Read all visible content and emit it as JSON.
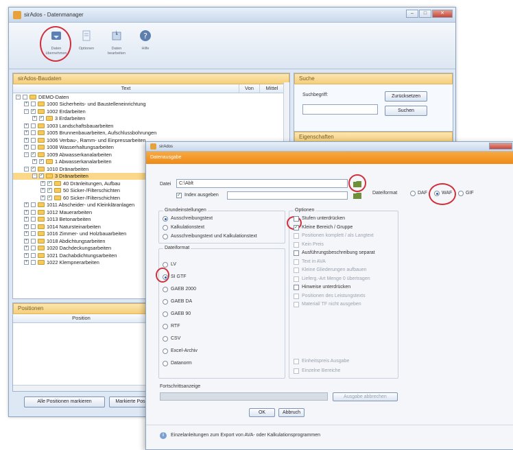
{
  "main_window": {
    "title": "sirAdos - Datenmanager",
    "controls": [
      "–",
      "□",
      "✕"
    ],
    "ribbon": [
      {
        "label": "Daten übernehmen",
        "icon": "data-transfer-icon"
      },
      {
        "label": "Optionen",
        "icon": "options-icon"
      },
      {
        "label": "Daten bearbeiten",
        "icon": "edit-data-icon"
      },
      {
        "label": "Hilfe",
        "icon": "help-icon"
      }
    ]
  },
  "left_panel": {
    "header": "sirAdos-Baudaten",
    "columns": [
      "Text",
      "Von",
      "Mittel"
    ],
    "rows": [
      {
        "indent": 0,
        "pm": "−",
        "checked": false,
        "text": "DEMO-Daten",
        "selected": false
      },
      {
        "indent": 1,
        "pm": "+",
        "checked": false,
        "text": "1000 Sicherheits- und Baustelleneinrichtung",
        "selected": false
      },
      {
        "indent": 1,
        "pm": "−",
        "checked": true,
        "text": "1002 Erdarbeiten",
        "selected": false
      },
      {
        "indent": 2,
        "pm": "+",
        "checked": true,
        "text": "3 Erdarbeiten",
        "selected": false
      },
      {
        "indent": 1,
        "pm": "+",
        "checked": false,
        "text": "1003 Landschaftsbauarbeiten",
        "selected": false
      },
      {
        "indent": 1,
        "pm": "+",
        "checked": false,
        "text": "1005 Brunnenbauarbeiten, Aufschlussbohrungen",
        "selected": false
      },
      {
        "indent": 1,
        "pm": "+",
        "checked": false,
        "text": "1006 Verbau-, Ramm- und Einpressarbeiten",
        "selected": false
      },
      {
        "indent": 1,
        "pm": "+",
        "checked": false,
        "text": "1008 Wasserhaltungsarbeiten",
        "selected": false
      },
      {
        "indent": 1,
        "pm": "−",
        "checked": true,
        "text": "1009 Abwasserkanalarbeiten",
        "selected": false
      },
      {
        "indent": 2,
        "pm": "+",
        "checked": true,
        "text": "1 Abwasserkanalarbeiten",
        "selected": false
      },
      {
        "indent": 1,
        "pm": "−",
        "checked": true,
        "text": "1010 Dränarbeiten",
        "selected": false
      },
      {
        "indent": 2,
        "pm": "−",
        "checked": true,
        "text": "3 Dränarbeiten",
        "selected": true
      },
      {
        "indent": 3,
        "pm": "+",
        "checked": true,
        "text": "40 Dränleitungen, Aufbau",
        "selected": false
      },
      {
        "indent": 3,
        "pm": "+",
        "checked": true,
        "text": "50 Sicker-/Filterschichten",
        "selected": false
      },
      {
        "indent": 3,
        "pm": "+",
        "checked": true,
        "text": "60 Sicker-/Filterschichten",
        "selected": false
      },
      {
        "indent": 1,
        "pm": "+",
        "checked": false,
        "text": "1011 Abscheider- und Kleinkläranlagen",
        "selected": false
      },
      {
        "indent": 1,
        "pm": "+",
        "checked": false,
        "text": "1012 Mauerarbeiten",
        "selected": false
      },
      {
        "indent": 1,
        "pm": "+",
        "checked": false,
        "text": "1013 Betonarbeiten",
        "selected": false
      },
      {
        "indent": 1,
        "pm": "+",
        "checked": false,
        "text": "1014 Natursteinarbeiten",
        "selected": false
      },
      {
        "indent": 1,
        "pm": "+",
        "checked": false,
        "text": "1016 Zimmer- und Holzbauarbeiten",
        "selected": false
      },
      {
        "indent": 1,
        "pm": "+",
        "checked": false,
        "text": "1018 Abdichtungsarbeiten",
        "selected": false
      },
      {
        "indent": 1,
        "pm": "+",
        "checked": false,
        "text": "1020 Dachdeckungsarbeiten",
        "selected": false
      },
      {
        "indent": 1,
        "pm": "+",
        "checked": false,
        "text": "1021 Dachabdichtungsarbeiten",
        "selected": false
      },
      {
        "indent": 1,
        "pm": "+",
        "checked": false,
        "text": "1022 Klempnerarbeiten",
        "selected": false
      }
    ]
  },
  "search_panel": {
    "header": "Suche",
    "label": "Suchbegriff:",
    "reset_button": "Zurücksetzen",
    "search_button": "Suchen"
  },
  "properties_panel": {
    "header": "Eigenschaften"
  },
  "bottom_panel": {
    "header": "Positionen",
    "column": "Position",
    "btn_all": "Alle Positionen markieren",
    "btn_marked": "Markierte Pos"
  },
  "dialog": {
    "title": "sirAdos",
    "header": "Datenausgabe",
    "file_label": "Datei",
    "file_value": "C:\\Ablt",
    "index_checkbox": "Index ausgeben",
    "format_label": "Dateiformat",
    "formats": [
      {
        "label": "DAF",
        "on": false
      },
      {
        "label": "WAF",
        "on": true
      },
      {
        "label": "GIF",
        "on": false
      }
    ],
    "group_settings": "Grundeinstellungen",
    "settings_options": [
      {
        "label": "Ausschreibungstext",
        "on": true
      },
      {
        "label": "Kalkulationstext",
        "on": false
      },
      {
        "label": "Ausschreibungstext und Kalkulationstext",
        "on": false
      }
    ],
    "group_format": "Dateiformat",
    "format_options": [
      {
        "label": "LV",
        "on": false
      },
      {
        "label": "SI GTF",
        "on": true
      },
      {
        "label": "GAEB 2000",
        "on": false
      },
      {
        "label": "GAEB DA",
        "on": false
      },
      {
        "label": "GAEB 90",
        "on": false
      },
      {
        "label": "RTF",
        "on": false
      },
      {
        "label": "CSV",
        "on": false
      },
      {
        "label": "Excel-Archiv",
        "on": false
      },
      {
        "label": "Datanorm",
        "on": false
      }
    ],
    "group_options": "Optionen",
    "options": [
      {
        "label": "Stufen unterdrücken",
        "checked": false,
        "disabled": false
      },
      {
        "label": "Kleine Bereich / Gruppe",
        "checked": true,
        "disabled": false
      },
      {
        "label": "Positionen komplett / als Langtext",
        "checked": false,
        "disabled": true
      },
      {
        "label": "Kein Preis",
        "checked": false,
        "disabled": true
      },
      {
        "label": "Ausführungsbeschreibung separat",
        "checked": false,
        "disabled": false
      },
      {
        "label": "Text in AVA",
        "checked": false,
        "disabled": true
      },
      {
        "label": "Kleine Gliederungen aufbauen",
        "checked": false,
        "disabled": true
      },
      {
        "label": "Lieferg.-Art Menge 0 übertragen",
        "checked": false,
        "disabled": true
      },
      {
        "label": "Hinweise unterdrücken",
        "checked": false,
        "disabled": false
      },
      {
        "label": "Positionen des Leistungstexts",
        "checked": false,
        "disabled": true
      },
      {
        "label": "Material/ TF nicht ausgeben",
        "checked": false,
        "disabled": true
      }
    ],
    "extra_options": [
      {
        "label": "Einheitspreis Ausgabe",
        "checked": false
      },
      {
        "label": "Einzelne Bereiche",
        "checked": false
      }
    ],
    "progress_label": "Fortschrittsanzeige",
    "cancel_export": "Ausgabe abbrechen",
    "ok": "OK",
    "cancel": "Abbruch",
    "info": "Einzelanleitungen zum Export von AVA- oder Kalkulationsprogrammen"
  }
}
